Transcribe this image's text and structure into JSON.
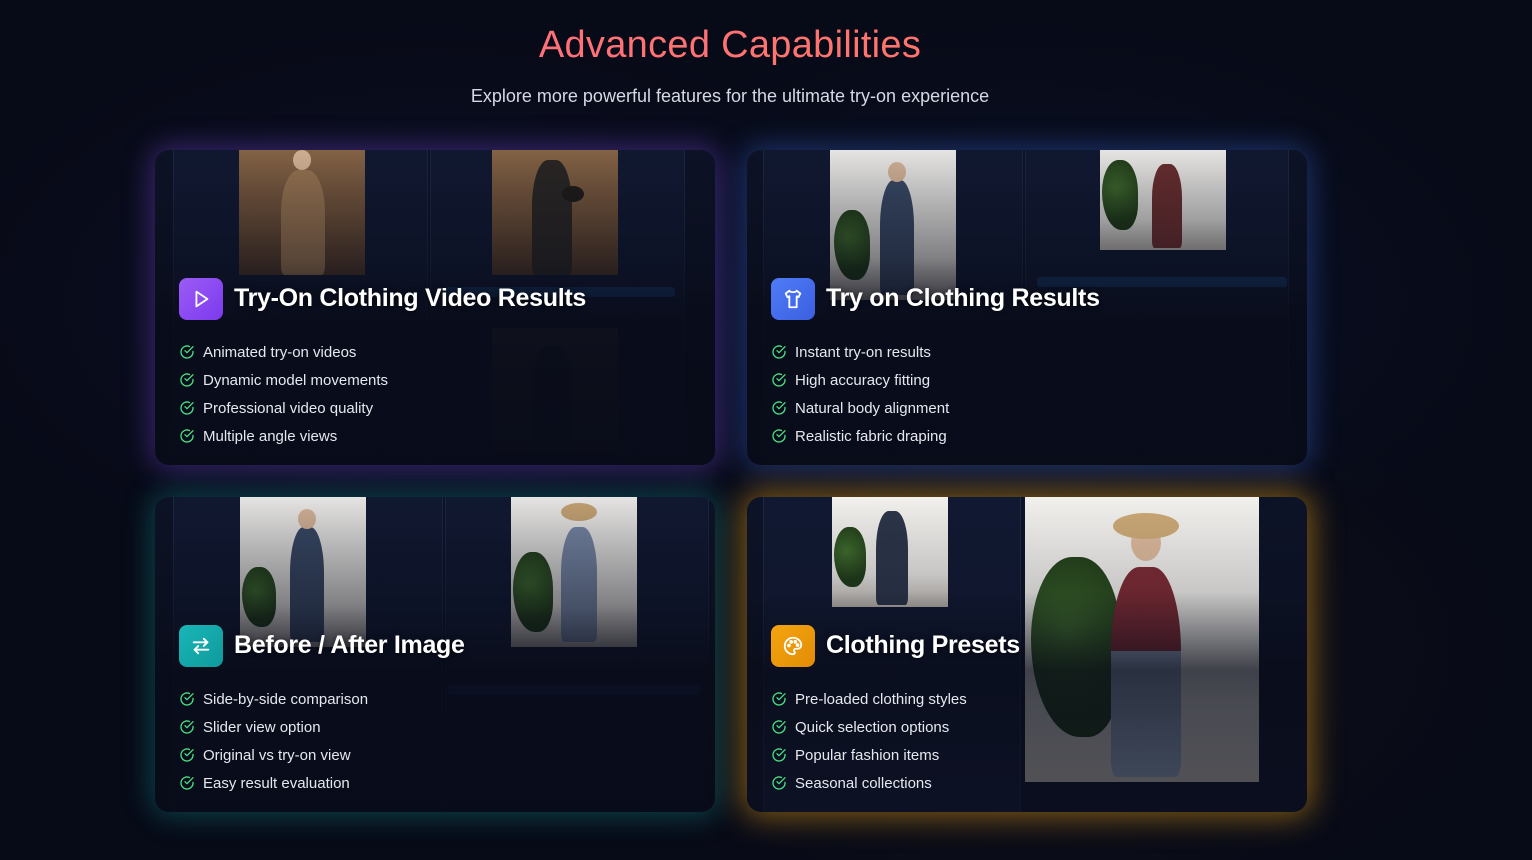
{
  "header": {
    "title": "Advanced Capabilities",
    "subtitle": "Explore more powerful features for the ultimate try-on experience"
  },
  "cards": [
    {
      "title": "Try-On Clothing Video Results",
      "icon": "play-icon",
      "accent": "#8b5cf6",
      "features": [
        "Animated try-on videos",
        "Dynamic model movements",
        "Professional video quality",
        "Multiple angle views"
      ]
    },
    {
      "title": "Try on Clothing Results",
      "icon": "shirt-icon",
      "accent": "#4f7cf7",
      "features": [
        "Instant try-on results",
        "High accuracy fitting",
        "Natural body alignment",
        "Realistic fabric draping"
      ]
    },
    {
      "title": "Before / After Image",
      "icon": "swap-arrows-icon",
      "accent": "#19b6b8",
      "features": [
        "Side-by-side comparison",
        "Slider view option",
        "Original vs try-on view",
        "Easy result evaluation"
      ]
    },
    {
      "title": "Clothing Presets",
      "icon": "palette-icon",
      "accent": "#f5a50f",
      "features": [
        "Pre-loaded clothing styles",
        "Quick selection options",
        "Popular fashion items",
        "Seasonal collections"
      ]
    }
  ],
  "colors": {
    "background": "#070a17",
    "title_gradient": [
      "#ff6b8b",
      "#ff7a59"
    ],
    "check": "#4ade80"
  }
}
